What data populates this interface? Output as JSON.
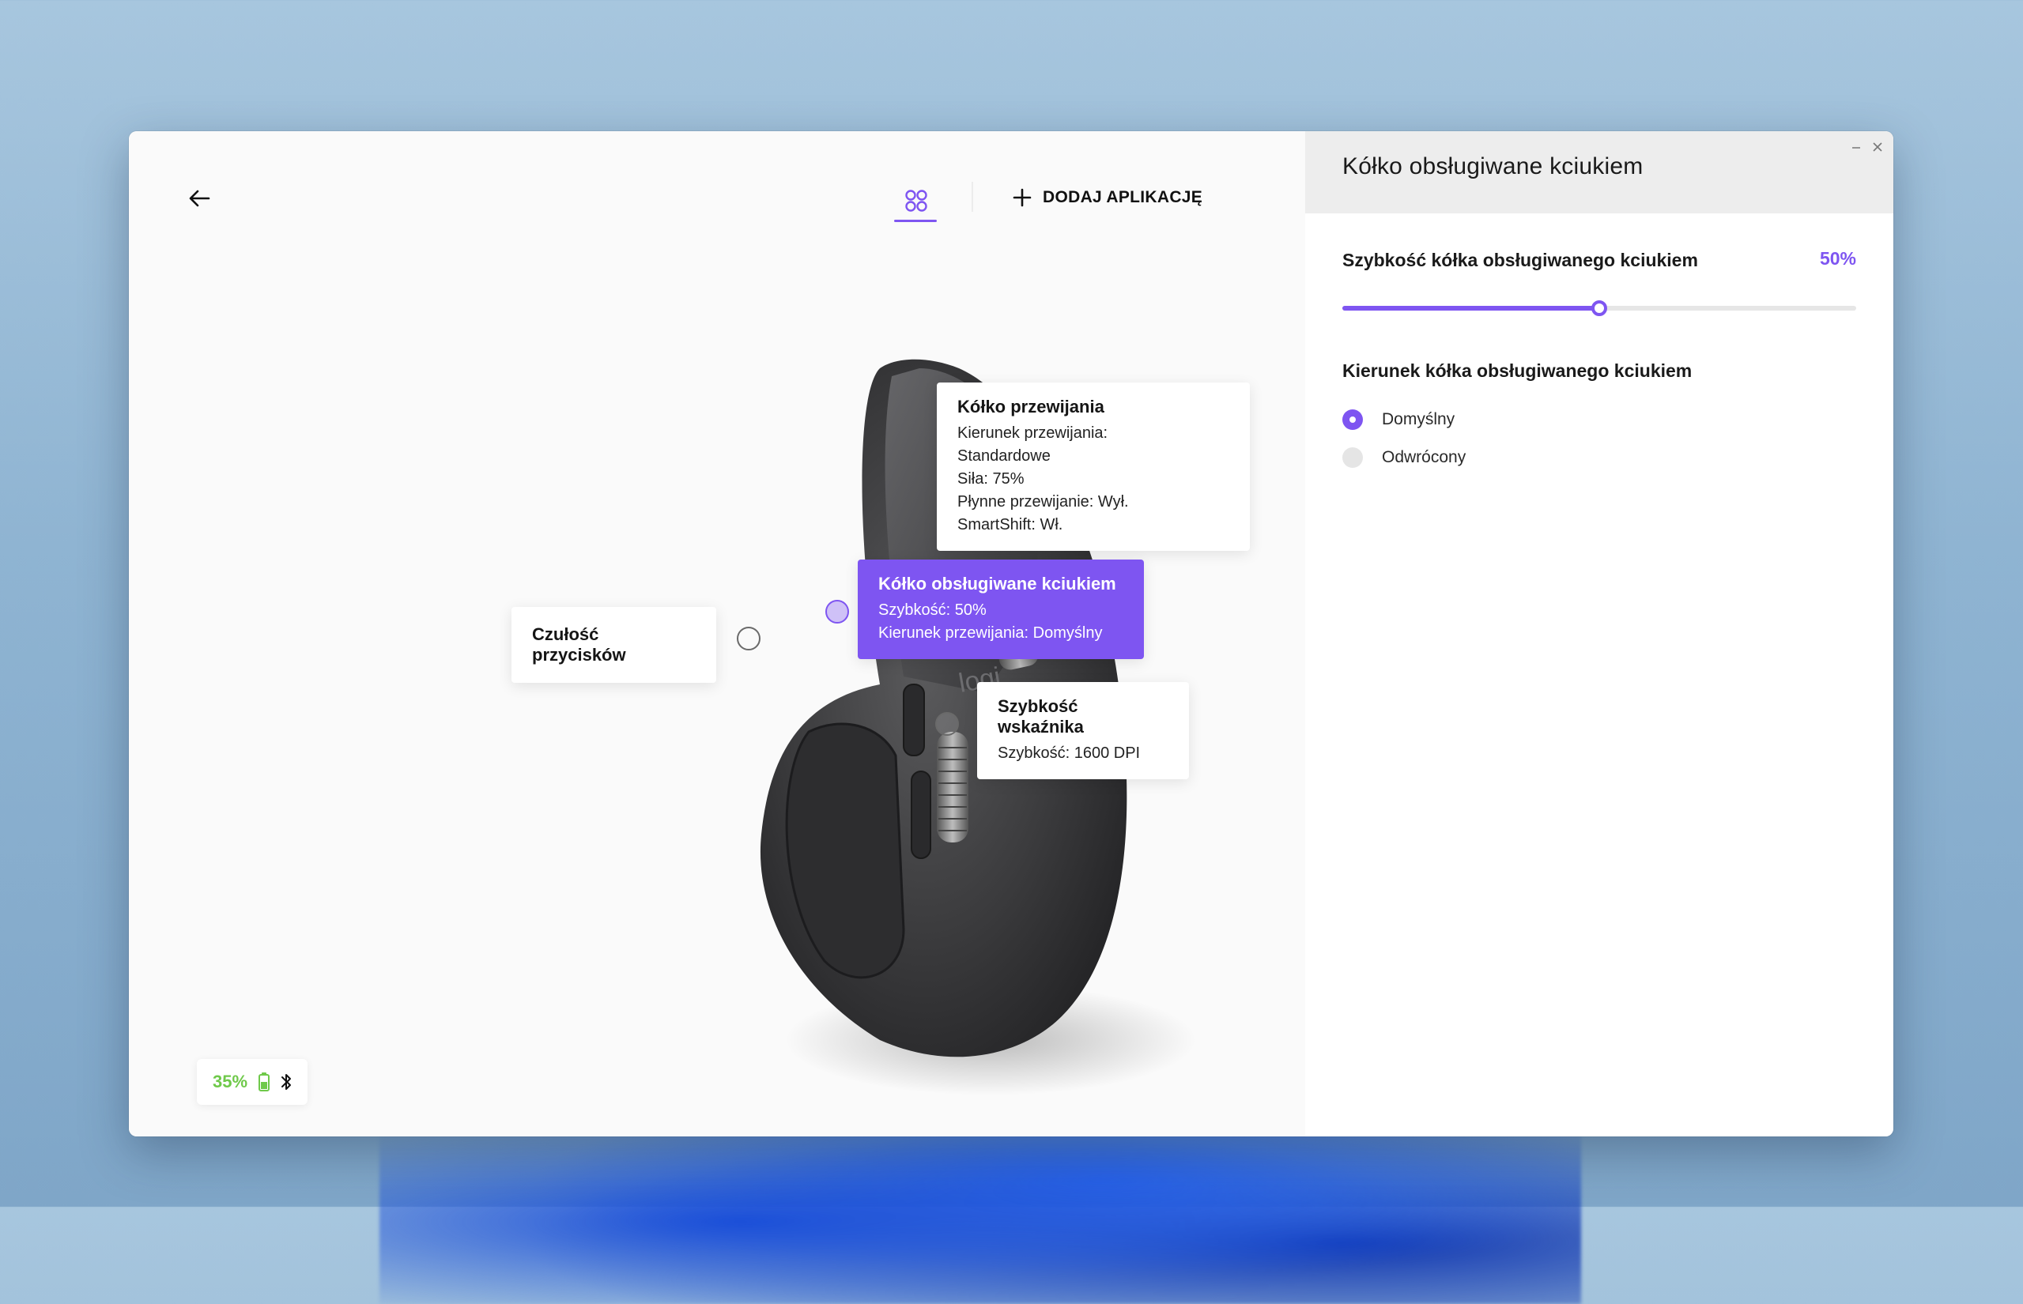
{
  "toolbar": {
    "add_app_label": "DODAJ APLIKACJĘ"
  },
  "callouts": {
    "scroll_wheel": {
      "title": "Kółko przewijania",
      "lines": [
        "Kierunek przewijania:",
        "Standardowe",
        "Siła: 75%",
        "Płynne przewijanie: Wył.",
        "SmartShift: Wł."
      ]
    },
    "thumb_wheel": {
      "title": "Kółko obsługiwane kciukiem",
      "lines": [
        "Szybkość: 50%",
        "Kierunek przewijania: Domyślny"
      ]
    },
    "button_sensitivity": {
      "title": "Czułość przycisków"
    },
    "pointer_speed": {
      "title": "Szybkość wskaźnika",
      "lines": [
        "Szybkość: 1600 DPI"
      ]
    }
  },
  "status": {
    "battery_percent_label": "35%",
    "battery_color": "#6fc94a",
    "battery_icon": "battery-icon",
    "connection_icon": "bluetooth-icon"
  },
  "panel": {
    "title": "Kółko obsługiwane kciukiem",
    "speed": {
      "label": "Szybkość kółka obsługiwanego kciukiem",
      "value_label": "50%",
      "value": 50
    },
    "direction": {
      "label": "Kierunek kółka obsługiwanego kciukiem",
      "options": [
        {
          "label": "Domyślny",
          "selected": true
        },
        {
          "label": "Odwrócony",
          "selected": false
        }
      ]
    }
  },
  "theme": {
    "accent": "#7e55f1"
  }
}
